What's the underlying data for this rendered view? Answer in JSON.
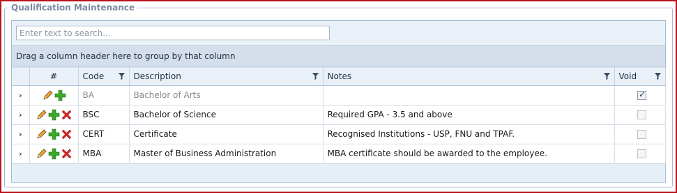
{
  "panel": {
    "legend": "Qualification Maintenance"
  },
  "search": {
    "placeholder": "Enter text to search..."
  },
  "group_panel": {
    "text": "Drag a column header here to group by that column"
  },
  "columns": {
    "hash": "#",
    "code": "Code",
    "description": "Description",
    "notes": "Notes",
    "void": "Void"
  },
  "rows": [
    {
      "code": "BA",
      "description": "Bachelor of Arts",
      "notes": "",
      "void": true,
      "deletable": false
    },
    {
      "code": "BSC",
      "description": "Bachelor of Science",
      "notes": "Required GPA - 3.5 and above",
      "void": false,
      "deletable": true
    },
    {
      "code": "CERT",
      "description": "Certificate",
      "notes": "Recognised Institutions - USP, FNU and TPAF.",
      "void": false,
      "deletable": true
    },
    {
      "code": "MBA",
      "description": "Master of Business Administration",
      "notes": "MBA certificate should be awarded to the employee.",
      "void": false,
      "deletable": true
    }
  ],
  "icons": {
    "expand": "expand-arrow-icon",
    "edit": "edit-pencil-icon",
    "add": "add-plus-icon",
    "delete": "delete-x-icon",
    "filter": "filter-funnel-icon"
  },
  "colors": {
    "frame_border": "#b8111a",
    "grid_header": "#e9f0f7",
    "group_panel": "#d4dfeb",
    "add_green": "#3aa82a",
    "delete_red": "#d6262b"
  }
}
